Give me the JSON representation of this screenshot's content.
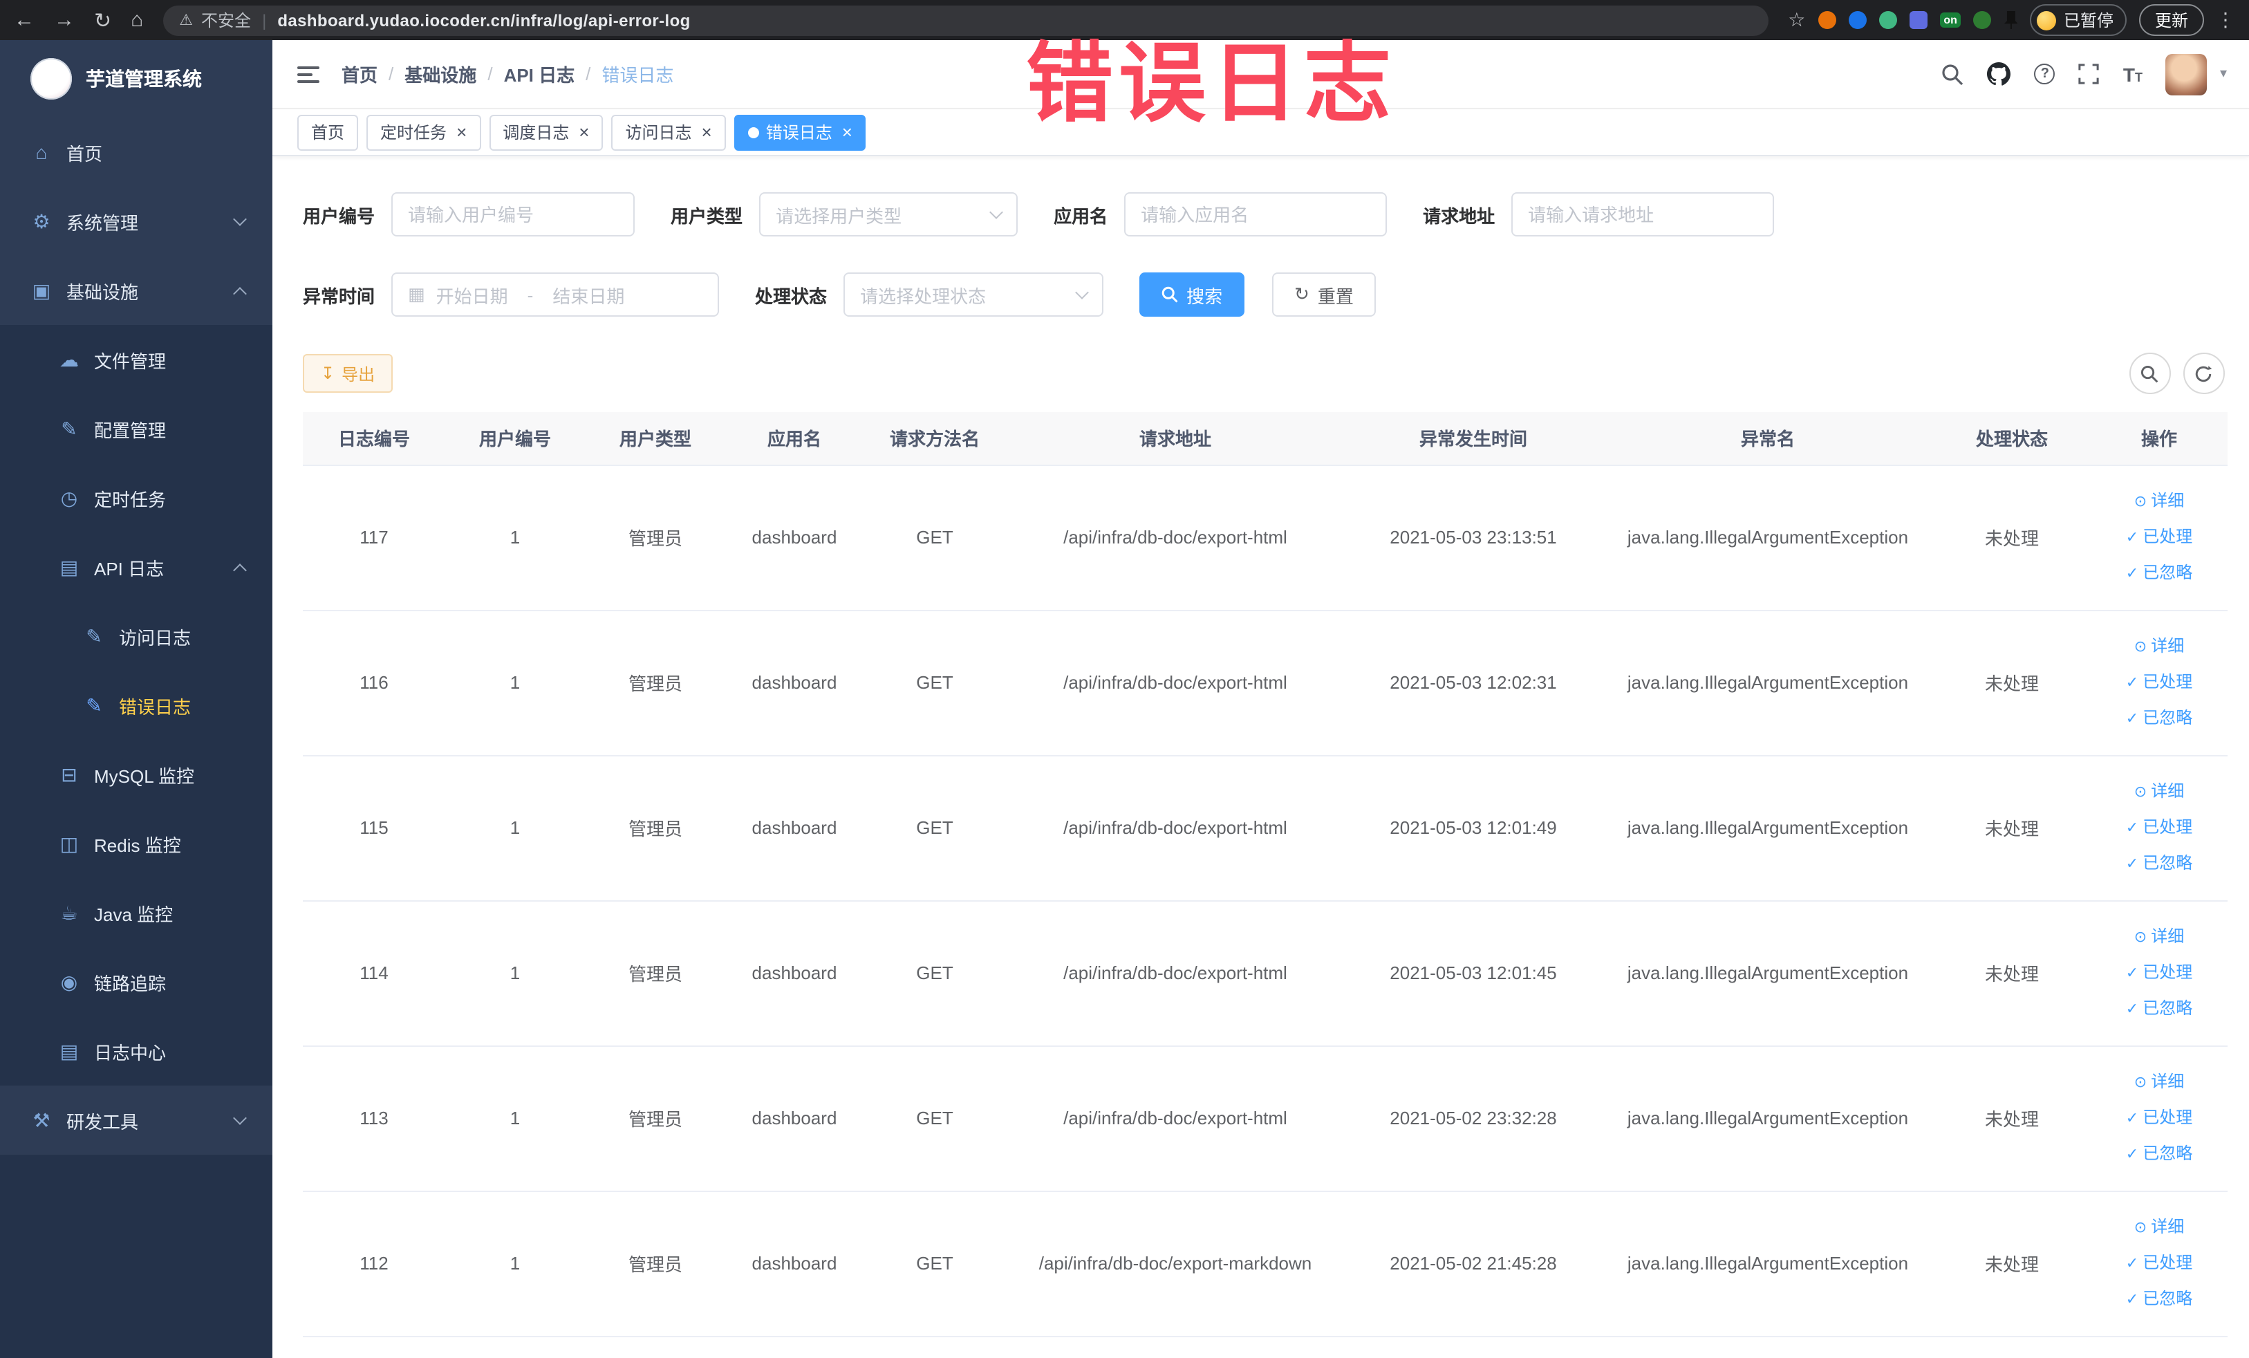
{
  "browser": {
    "security_label": "不安全",
    "url": "dashboard.yudao.iocoder.cn/infra/log/api-error-log",
    "extension_badge": "on",
    "paused_badge": "已暂停",
    "update_label": "更新"
  },
  "watermark": "错误日志",
  "sidebar": {
    "title": "芋道管理系统",
    "menu": [
      {
        "label": "首页",
        "icon": "home-icon",
        "level": 1
      },
      {
        "label": "系统管理",
        "icon": "gear-icon",
        "level": 1,
        "arrow": "down"
      },
      {
        "label": "基础设施",
        "icon": "monitor-icon",
        "level": 1,
        "arrow": "up"
      },
      {
        "label": "文件管理",
        "icon": "cloud-icon",
        "level": 2
      },
      {
        "label": "配置管理",
        "icon": "edit-icon",
        "level": 2
      },
      {
        "label": "定时任务",
        "icon": "clock-icon",
        "level": 2
      },
      {
        "label": "API 日志",
        "icon": "document-icon",
        "level": 2,
        "arrow": "up"
      },
      {
        "label": "访问日志",
        "icon": "log-icon",
        "level": 3
      },
      {
        "label": "错误日志",
        "icon": "log-icon",
        "level": 3,
        "active": true
      },
      {
        "label": "MySQL 监控",
        "icon": "database-icon",
        "level": 2
      },
      {
        "label": "Redis 监控",
        "icon": "layers-icon",
        "level": 2
      },
      {
        "label": "Java 监控",
        "icon": "coffee-icon",
        "level": 2
      },
      {
        "label": "链路追踪",
        "icon": "eye-icon",
        "level": 2
      },
      {
        "label": "日志中心",
        "icon": "document-icon",
        "level": 2
      },
      {
        "label": "研发工具",
        "icon": "tools-icon",
        "level": 1,
        "arrow": "down"
      }
    ]
  },
  "header": {
    "breadcrumb": [
      "首页",
      "基础设施",
      "API 日志",
      "错误日志"
    ],
    "breadcrumb_separator": "/"
  },
  "tabs": [
    {
      "label": "首页",
      "closable": false,
      "active": false
    },
    {
      "label": "定时任务",
      "closable": true,
      "active": false
    },
    {
      "label": "调度日志",
      "closable": true,
      "active": false
    },
    {
      "label": "访问日志",
      "closable": true,
      "active": false
    },
    {
      "label": "错误日志",
      "closable": true,
      "active": true
    }
  ],
  "filters": {
    "user_id_label": "用户编号",
    "user_id_placeholder": "请输入用户编号",
    "user_type_label": "用户类型",
    "user_type_placeholder": "请选择用户类型",
    "app_name_label": "应用名",
    "app_name_placeholder": "请输入应用名",
    "request_url_label": "请求地址",
    "request_url_placeholder": "请输入请求地址",
    "time_label": "异常时间",
    "time_start_placeholder": "开始日期",
    "time_separator": "-",
    "time_end_placeholder": "结束日期",
    "status_label": "处理状态",
    "status_placeholder": "请选择处理状态",
    "search_label": "搜索",
    "reset_label": "重置"
  },
  "toolbar": {
    "export_label": "导出"
  },
  "table": {
    "columns": [
      "日志编号",
      "用户编号",
      "用户类型",
      "应用名",
      "请求方法名",
      "请求地址",
      "异常发生时间",
      "异常名",
      "处理状态",
      "操作"
    ],
    "actions": [
      {
        "label": "详细",
        "icon": "detail-eye-icon"
      },
      {
        "label": "已处理",
        "icon": "check-icon"
      },
      {
        "label": "已忽略",
        "icon": "check-icon"
      }
    ],
    "rows": [
      {
        "id": "117",
        "user_id": "1",
        "user_type": "管理员",
        "app": "dashboard",
        "method": "GET",
        "url": "/api/infra/db-doc/export-html",
        "time": "2021-05-03 23:13:51",
        "exception": "java.lang.IllegalArgumentException",
        "status": "未处理"
      },
      {
        "id": "116",
        "user_id": "1",
        "user_type": "管理员",
        "app": "dashboard",
        "method": "GET",
        "url": "/api/infra/db-doc/export-html",
        "time": "2021-05-03 12:02:31",
        "exception": "java.lang.IllegalArgumentException",
        "status": "未处理"
      },
      {
        "id": "115",
        "user_id": "1",
        "user_type": "管理员",
        "app": "dashboard",
        "method": "GET",
        "url": "/api/infra/db-doc/export-html",
        "time": "2021-05-03 12:01:49",
        "exception": "java.lang.IllegalArgumentException",
        "status": "未处理"
      },
      {
        "id": "114",
        "user_id": "1",
        "user_type": "管理员",
        "app": "dashboard",
        "method": "GET",
        "url": "/api/infra/db-doc/export-html",
        "time": "2021-05-03 12:01:45",
        "exception": "java.lang.IllegalArgumentException",
        "status": "未处理"
      },
      {
        "id": "113",
        "user_id": "1",
        "user_type": "管理员",
        "app": "dashboard",
        "method": "GET",
        "url": "/api/infra/db-doc/export-html",
        "time": "2021-05-02 23:32:28",
        "exception": "java.lang.IllegalArgumentException",
        "status": "未处理"
      },
      {
        "id": "112",
        "user_id": "1",
        "user_type": "管理员",
        "app": "dashboard",
        "method": "GET",
        "url": "/api/infra/db-doc/export-markdown",
        "time": "2021-05-02 21:45:28",
        "exception": "java.lang.IllegalArgumentException",
        "status": "未处理"
      }
    ]
  }
}
